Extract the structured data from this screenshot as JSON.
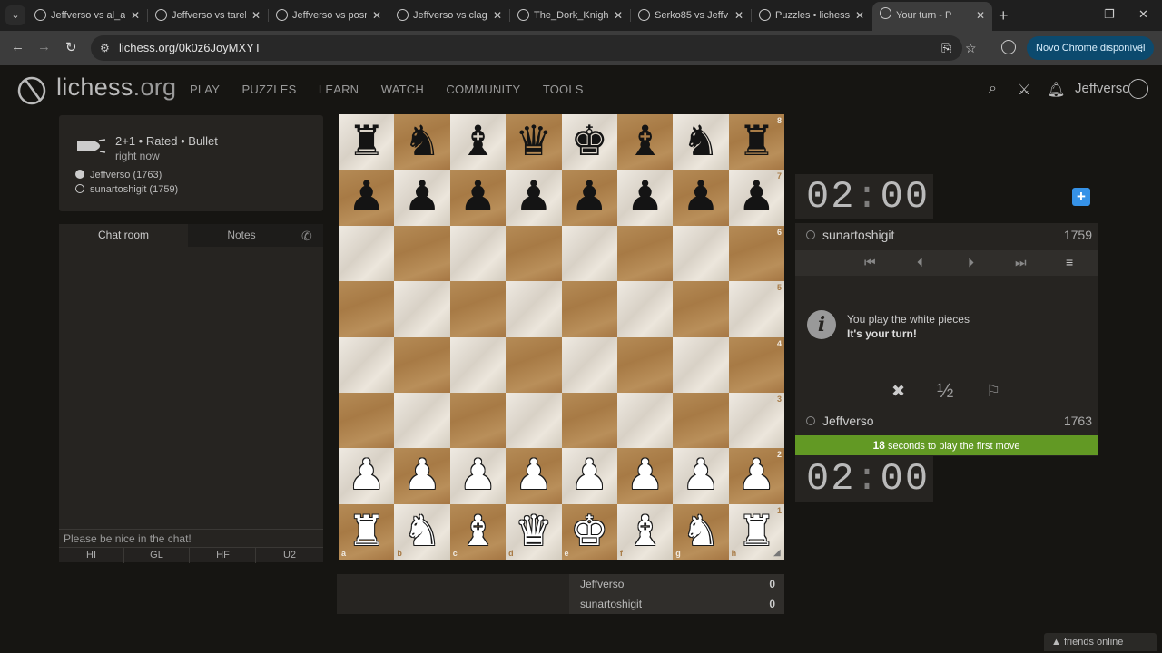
{
  "browser": {
    "tabs": [
      {
        "title": "Jeffverso vs al_ar"
      },
      {
        "title": "Jeffverso vs tarel"
      },
      {
        "title": "Jeffverso vs posn"
      },
      {
        "title": "Jeffverso vs clag"
      },
      {
        "title": "The_Dork_Knight"
      },
      {
        "title": "Serko85 vs Jeffv"
      },
      {
        "title": "Puzzles • lichess"
      },
      {
        "title": "Your turn - P"
      }
    ],
    "url": "lichess.org/0k0z6JoyMXYT",
    "update_label": "Novo Chrome disponível"
  },
  "site": {
    "logo_main": "lichess",
    "logo_tld": ".org",
    "nav": [
      "PLAY",
      "PUZZLES",
      "LEARN",
      "WATCH",
      "COMMUNITY",
      "TOOLS"
    ],
    "username": "Jeffverso"
  },
  "game": {
    "type_line": "2+1 • Rated • Bullet",
    "time_ago": "right now",
    "white_player": "Jeffverso (1763)",
    "black_player": "sunartoshigit (1759)"
  },
  "chat": {
    "tab_chat": "Chat room",
    "tab_notes": "Notes",
    "placeholder": "Please be nice in the chat!",
    "presets": [
      "HI",
      "GL",
      "HF",
      "U2"
    ]
  },
  "board": {
    "files": [
      "a",
      "b",
      "c",
      "d",
      "e",
      "f",
      "g",
      "h"
    ],
    "ranks": [
      "8",
      "7",
      "6",
      "5",
      "4",
      "3",
      "2",
      "1"
    ],
    "position": [
      [
        "r",
        "n",
        "b",
        "q",
        "k",
        "b",
        "n",
        "r"
      ],
      [
        "p",
        "p",
        "p",
        "p",
        "p",
        "p",
        "p",
        "p"
      ],
      [
        "",
        "",
        "",
        "",
        "",
        "",
        "",
        ""
      ],
      [
        "",
        "",
        "",
        "",
        "",
        "",
        "",
        ""
      ],
      [
        "",
        "",
        "",
        "",
        "",
        "",
        "",
        ""
      ],
      [
        "",
        "",
        "",
        "",
        "",
        "",
        "",
        ""
      ],
      [
        "P",
        "P",
        "P",
        "P",
        "P",
        "P",
        "P",
        "P"
      ],
      [
        "R",
        "N",
        "B",
        "Q",
        "K",
        "B",
        "N",
        "R"
      ]
    ]
  },
  "crosstable": {
    "rows": [
      {
        "name": "Jeffverso",
        "score": "0"
      },
      {
        "name": "sunartoshigit",
        "score": "0"
      }
    ]
  },
  "right": {
    "top_clock_min": "02",
    "top_clock_sec": "00",
    "bottom_clock_min": "02",
    "bottom_clock_sec": "00",
    "opponent": {
      "name": "sunartoshigit",
      "rating": "1759"
    },
    "me": {
      "name": "Jeffverso",
      "rating": "1763"
    },
    "message_line1": "You play the white pieces",
    "message_line2": "It's your turn!",
    "first_move_seconds": "18",
    "first_move_text": " seconds to play the first move",
    "draw_label": "½"
  },
  "footer": {
    "friends_label": "▲ friends online"
  },
  "colors": {
    "background": "#161512",
    "panel": "#262421",
    "accent_green": "#629924",
    "accent_blue": "#3692e7",
    "update_pill": "#0c4a6e"
  }
}
